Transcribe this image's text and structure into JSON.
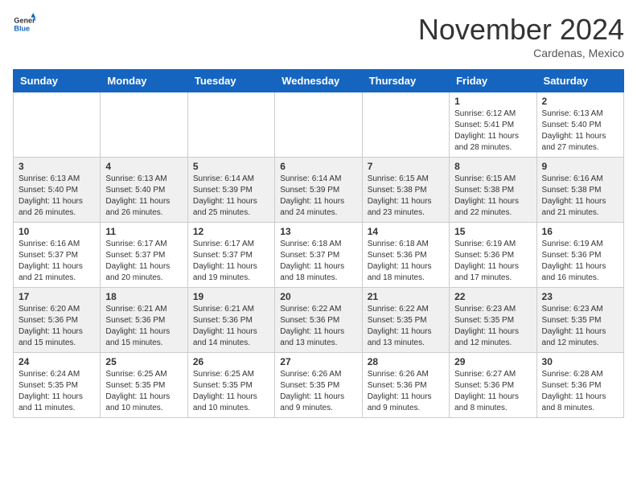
{
  "header": {
    "logo_line1": "General",
    "logo_line2": "Blue",
    "month": "November 2024",
    "location": "Cardenas, Mexico"
  },
  "weekdays": [
    "Sunday",
    "Monday",
    "Tuesday",
    "Wednesday",
    "Thursday",
    "Friday",
    "Saturday"
  ],
  "weeks": [
    [
      {
        "day": "",
        "info": ""
      },
      {
        "day": "",
        "info": ""
      },
      {
        "day": "",
        "info": ""
      },
      {
        "day": "",
        "info": ""
      },
      {
        "day": "",
        "info": ""
      },
      {
        "day": "1",
        "info": "Sunrise: 6:12 AM\nSunset: 5:41 PM\nDaylight: 11 hours and 28 minutes."
      },
      {
        "day": "2",
        "info": "Sunrise: 6:13 AM\nSunset: 5:40 PM\nDaylight: 11 hours and 27 minutes."
      }
    ],
    [
      {
        "day": "3",
        "info": "Sunrise: 6:13 AM\nSunset: 5:40 PM\nDaylight: 11 hours and 26 minutes."
      },
      {
        "day": "4",
        "info": "Sunrise: 6:13 AM\nSunset: 5:40 PM\nDaylight: 11 hours and 26 minutes."
      },
      {
        "day": "5",
        "info": "Sunrise: 6:14 AM\nSunset: 5:39 PM\nDaylight: 11 hours and 25 minutes."
      },
      {
        "day": "6",
        "info": "Sunrise: 6:14 AM\nSunset: 5:39 PM\nDaylight: 11 hours and 24 minutes."
      },
      {
        "day": "7",
        "info": "Sunrise: 6:15 AM\nSunset: 5:38 PM\nDaylight: 11 hours and 23 minutes."
      },
      {
        "day": "8",
        "info": "Sunrise: 6:15 AM\nSunset: 5:38 PM\nDaylight: 11 hours and 22 minutes."
      },
      {
        "day": "9",
        "info": "Sunrise: 6:16 AM\nSunset: 5:38 PM\nDaylight: 11 hours and 21 minutes."
      }
    ],
    [
      {
        "day": "10",
        "info": "Sunrise: 6:16 AM\nSunset: 5:37 PM\nDaylight: 11 hours and 21 minutes."
      },
      {
        "day": "11",
        "info": "Sunrise: 6:17 AM\nSunset: 5:37 PM\nDaylight: 11 hours and 20 minutes."
      },
      {
        "day": "12",
        "info": "Sunrise: 6:17 AM\nSunset: 5:37 PM\nDaylight: 11 hours and 19 minutes."
      },
      {
        "day": "13",
        "info": "Sunrise: 6:18 AM\nSunset: 5:37 PM\nDaylight: 11 hours and 18 minutes."
      },
      {
        "day": "14",
        "info": "Sunrise: 6:18 AM\nSunset: 5:36 PM\nDaylight: 11 hours and 18 minutes."
      },
      {
        "day": "15",
        "info": "Sunrise: 6:19 AM\nSunset: 5:36 PM\nDaylight: 11 hours and 17 minutes."
      },
      {
        "day": "16",
        "info": "Sunrise: 6:19 AM\nSunset: 5:36 PM\nDaylight: 11 hours and 16 minutes."
      }
    ],
    [
      {
        "day": "17",
        "info": "Sunrise: 6:20 AM\nSunset: 5:36 PM\nDaylight: 11 hours and 15 minutes."
      },
      {
        "day": "18",
        "info": "Sunrise: 6:21 AM\nSunset: 5:36 PM\nDaylight: 11 hours and 15 minutes."
      },
      {
        "day": "19",
        "info": "Sunrise: 6:21 AM\nSunset: 5:36 PM\nDaylight: 11 hours and 14 minutes."
      },
      {
        "day": "20",
        "info": "Sunrise: 6:22 AM\nSunset: 5:36 PM\nDaylight: 11 hours and 13 minutes."
      },
      {
        "day": "21",
        "info": "Sunrise: 6:22 AM\nSunset: 5:35 PM\nDaylight: 11 hours and 13 minutes."
      },
      {
        "day": "22",
        "info": "Sunrise: 6:23 AM\nSunset: 5:35 PM\nDaylight: 11 hours and 12 minutes."
      },
      {
        "day": "23",
        "info": "Sunrise: 6:23 AM\nSunset: 5:35 PM\nDaylight: 11 hours and 12 minutes."
      }
    ],
    [
      {
        "day": "24",
        "info": "Sunrise: 6:24 AM\nSunset: 5:35 PM\nDaylight: 11 hours and 11 minutes."
      },
      {
        "day": "25",
        "info": "Sunrise: 6:25 AM\nSunset: 5:35 PM\nDaylight: 11 hours and 10 minutes."
      },
      {
        "day": "26",
        "info": "Sunrise: 6:25 AM\nSunset: 5:35 PM\nDaylight: 11 hours and 10 minutes."
      },
      {
        "day": "27",
        "info": "Sunrise: 6:26 AM\nSunset: 5:35 PM\nDaylight: 11 hours and 9 minutes."
      },
      {
        "day": "28",
        "info": "Sunrise: 6:26 AM\nSunset: 5:36 PM\nDaylight: 11 hours and 9 minutes."
      },
      {
        "day": "29",
        "info": "Sunrise: 6:27 AM\nSunset: 5:36 PM\nDaylight: 11 hours and 8 minutes."
      },
      {
        "day": "30",
        "info": "Sunrise: 6:28 AM\nSunset: 5:36 PM\nDaylight: 11 hours and 8 minutes."
      }
    ]
  ]
}
